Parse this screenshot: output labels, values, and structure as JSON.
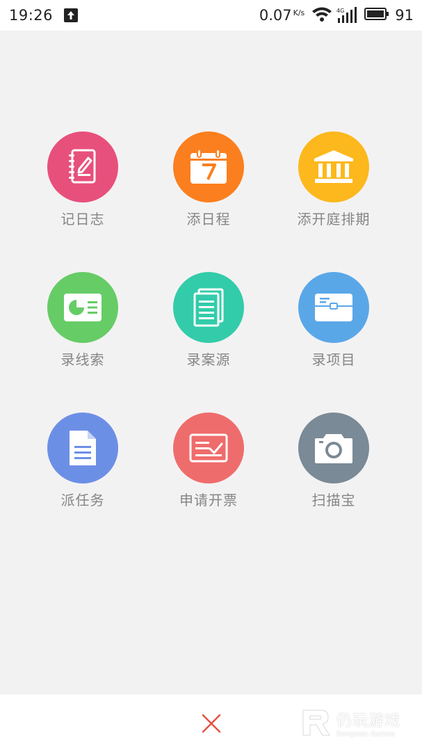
{
  "status_bar": {
    "time": "19:26",
    "net_speed": "0.07",
    "net_unit": "K/s",
    "network_type": "4G",
    "battery": "91"
  },
  "actions": [
    {
      "label": "记日志",
      "icon": "notebook-pen-icon",
      "color": "#e8507c"
    },
    {
      "label": "添日程",
      "icon": "calendar-icon",
      "color": "#fb7f1e"
    },
    {
      "label": "添开庭排期",
      "icon": "courthouse-icon",
      "color": "#fcb81c"
    },
    {
      "label": "录线索",
      "icon": "id-card-icon",
      "color": "#66cc66"
    },
    {
      "label": "录案源",
      "icon": "document-stack-icon",
      "color": "#33ccaa"
    },
    {
      "label": "录项目",
      "icon": "briefcase-icon",
      "color": "#5aa7e8"
    },
    {
      "label": "派任务",
      "icon": "file-icon",
      "color": "#6c8fe6"
    },
    {
      "label": "申请开票",
      "icon": "invoice-check-icon",
      "color": "#ef6c6c"
    },
    {
      "label": "扫描宝",
      "icon": "camera-icon",
      "color": "#7a8a96"
    }
  ],
  "bottom_bar": {
    "close_icon": "close-icon",
    "close_color": "#e4533e"
  },
  "watermark": {
    "title": "仍玩游戏",
    "subtitle": "Rengwan Games"
  }
}
